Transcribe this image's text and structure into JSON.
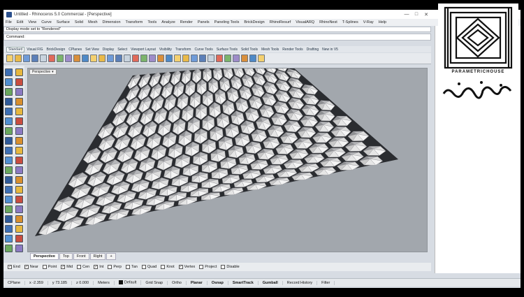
{
  "window": {
    "title": "Untitled - Rhinoceros 5.0 Commercial - [Perspective]",
    "controls": [
      "—",
      "□",
      "✕"
    ]
  },
  "menu": [
    "File",
    "Edit",
    "View",
    "Curve",
    "Surface",
    "Solid",
    "Mesh",
    "Dimension",
    "Transform",
    "Tools",
    "Analyze",
    "Render",
    "Panels",
    "Paneling Tools",
    "BrickDesign",
    "RhinoResurf",
    "VisualARQ",
    "RhinoNest",
    "T-Splines",
    "V-Ray",
    "Help"
  ],
  "command": {
    "history": "Display mode set to \"Rendered\"",
    "label": "Command:",
    "value": ""
  },
  "toolbar_tabs": [
    "Standard",
    "Visual FIG",
    "BrickDesign",
    "CPlanes",
    "Set View",
    "Display",
    "Select",
    "Viewport Layout",
    "Visibility",
    "Transform",
    "Curve Tools",
    "Surface Tools",
    "Solid Tools",
    "Mesh Tools",
    "Render Tools",
    "Drafting",
    "New in V5"
  ],
  "toolbar_active_tab": "Standard",
  "toolbar_icons": [
    "new-icon",
    "open-icon",
    "save-icon",
    "print-icon",
    "import-icon",
    "cut-icon",
    "copy-icon",
    "paste-icon",
    "undo-icon",
    "redo-icon",
    "pan-icon",
    "rotate-view-icon",
    "zoom-icon",
    "zoom-window-icon",
    "zoom-extents-icon",
    "zoom-selected-icon",
    "four-views-icon",
    "grid-icon",
    "cplane-icon",
    "shade-icon",
    "render-icon",
    "lights-icon",
    "material-icon",
    "layer-icon",
    "object-properties-icon",
    "osnap-icon",
    "help-icon",
    "options-icon",
    "spiral-icon",
    "teapot-icon",
    "vray-icon"
  ],
  "side_tools": [
    "select-arrow-icon",
    "point-icon",
    "polyline-icon",
    "line-icon",
    "circle-icon",
    "arc-icon",
    "rectangle-icon",
    "polygon-icon",
    "curve-icon",
    "freeform-icon",
    "fillet-icon",
    "offset-icon",
    "sphere-icon",
    "box-icon",
    "cylinder-icon",
    "extrude-icon",
    "loft-icon",
    "sweep-icon",
    "trim-icon",
    "split-icon",
    "join-icon",
    "explode-icon",
    "move-icon",
    "rotate-icon",
    "scale-icon",
    "mirror-icon",
    "array-icon",
    "boolean-icon",
    "group-icon",
    "ungroup-icon",
    "mesh-icon",
    "text-icon",
    "dimension-icon",
    "point-edit-icon",
    "render-side-icon",
    "hide-icon",
    "lock-icon",
    "analyze-icon"
  ],
  "viewport": {
    "label": "Perspective",
    "dropdown": "▾"
  },
  "view_tabs": [
    "Perspective",
    "Top",
    "Front",
    "Right"
  ],
  "view_tab_add": "+",
  "osnaps": [
    {
      "label": "End",
      "checked": true
    },
    {
      "label": "Near",
      "checked": true
    },
    {
      "label": "Point",
      "checked": false
    },
    {
      "label": "Mid",
      "checked": true
    },
    {
      "label": "Cen",
      "checked": false
    },
    {
      "label": "Int",
      "checked": true
    },
    {
      "label": "Perp",
      "checked": false
    },
    {
      "label": "Tan",
      "checked": false
    },
    {
      "label": "Quad",
      "checked": false
    },
    {
      "label": "Knot",
      "checked": false
    },
    {
      "label": "Vertex",
      "checked": true
    },
    {
      "label": "Project",
      "checked": false
    },
    {
      "label": "Disable",
      "checked": false
    }
  ],
  "status": {
    "cplane": "CPlane",
    "x": "x -2.359",
    "y": "y 73.185",
    "z": "z 0.000",
    "units": "Meters",
    "layer": "Default",
    "toggles": [
      "Grid Snap",
      "Ortho",
      "Planar",
      "Osnap",
      "SmartTrack",
      "Gumball",
      "Record History",
      "Filter"
    ]
  },
  "colors": {
    "viewport_bg": "#a2a7ad",
    "panel_bg": "#e7eaee",
    "accent": "#2a4f8c"
  }
}
